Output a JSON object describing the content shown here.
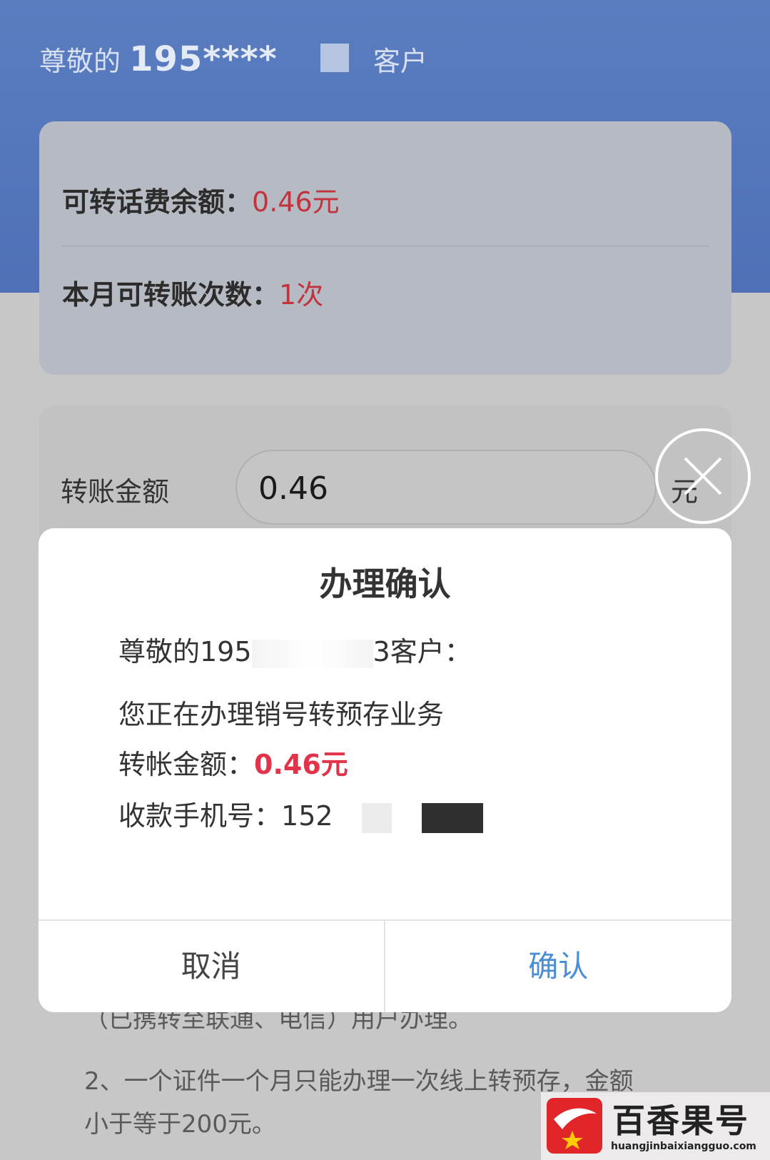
{
  "header": {
    "greeting_prefix": "尊敬的",
    "masked_number": "195****",
    "greeting_suffix": "客户"
  },
  "balance_card": {
    "balance_label": "可转话费余额：",
    "balance_value": "0.46元",
    "count_label": "本月可转账次数：",
    "count_value": "1次"
  },
  "form": {
    "amount_label": "转账金额",
    "amount_value": "0.46",
    "amount_unit": "元"
  },
  "notes": {
    "line1": "（已携转至联通、电信）用户办理。",
    "line2": "2、一个证件一个月只能办理一次线上转预存，金额",
    "line3": "小于等于200元。"
  },
  "dialog": {
    "title": "办理确认",
    "greeting_prefix": "尊敬的195",
    "greeting_suffix": "3客户：",
    "business": "您正在办理销号转预存业务",
    "amount_label": "转帐金额：",
    "amount_value": "0.46元",
    "phone_label": "收款手机号：",
    "phone_prefix": "152",
    "cancel_label": "取消",
    "confirm_label": "确认"
  },
  "watermark": {
    "brand": "百香果号",
    "url": "huangjinbaixiangguo.com"
  },
  "colors": {
    "header": "#4f70b6",
    "accent_red": "#e2334a",
    "confirm_blue": "#4a8fd6"
  }
}
